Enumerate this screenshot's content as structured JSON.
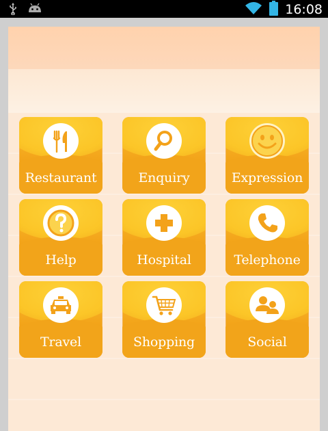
{
  "status_bar": {
    "time": "16:08",
    "icons": [
      "usb-icon",
      "android-debug-icon",
      "wifi-icon",
      "battery-icon"
    ]
  },
  "colors": {
    "tile": "#f3a21a",
    "tile_highlight": "#ffd53a",
    "header": "#ffd2ad",
    "background": "#fde9d6"
  },
  "menu": {
    "items": [
      {
        "label": "Restaurant",
        "icon": "fork-knife-icon"
      },
      {
        "label": "Enquiry",
        "icon": "magnifier-icon"
      },
      {
        "label": "Expression",
        "icon": "smiley-icon"
      },
      {
        "label": "Help",
        "icon": "question-icon"
      },
      {
        "label": "Hospital",
        "icon": "medical-cross-icon"
      },
      {
        "label": "Telephone",
        "icon": "phone-icon"
      },
      {
        "label": "Travel",
        "icon": "taxi-icon"
      },
      {
        "label": "Shopping",
        "icon": "shopping-cart-icon"
      },
      {
        "label": "Social",
        "icon": "people-icon"
      }
    ]
  }
}
